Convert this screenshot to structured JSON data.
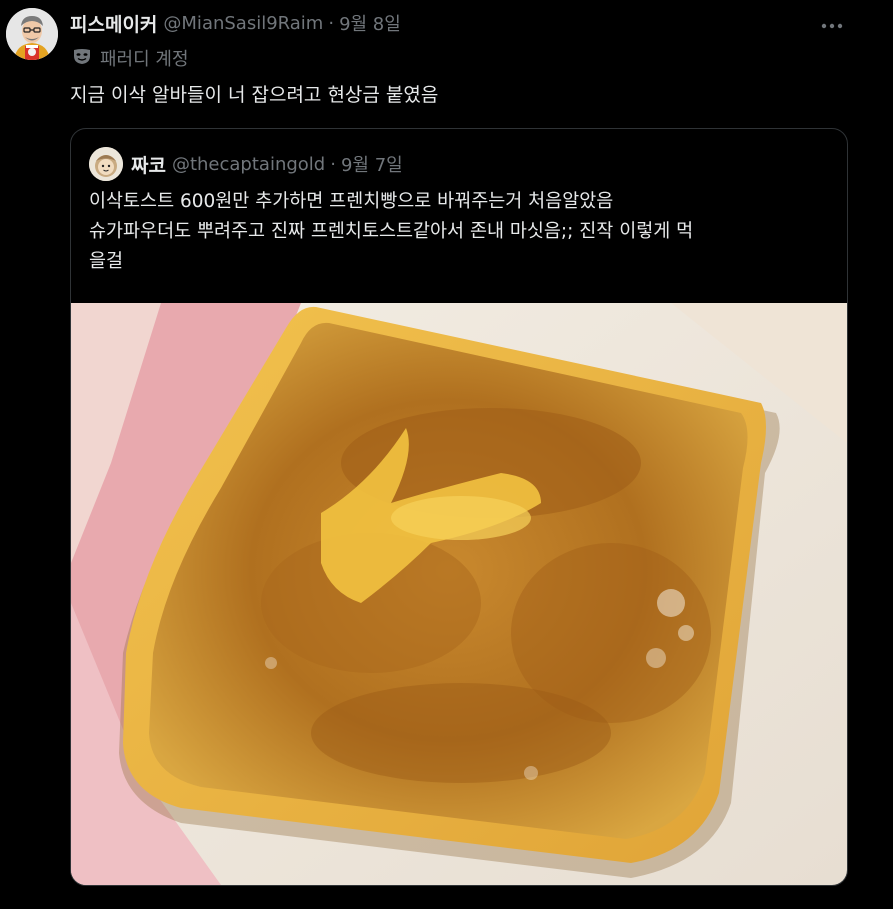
{
  "tweet": {
    "display_name": "피스메이커",
    "handle": "@MianSasil9Raim",
    "separator": "·",
    "date": "9월 8일",
    "label": "패러디 계정",
    "text": "지금 이삭 알바들이 너 잡으려고 현상금 붙였음",
    "more_icon": "more-horizontal-icon",
    "label_icon": "mask-icon"
  },
  "quote": {
    "display_name": "짜코",
    "handle": "@thecaptaingold",
    "separator": "·",
    "date": "9월 7일",
    "text_lines": [
      "이삭토스트 600원만 추가하면 프렌치빵으로 바꿔주는거 처음알았음",
      " 슈가파우더도 뿌려주고 진짜 프렌치토스트같아서 존내 마싯음;; 진작 이렇게 먹",
      "을걸"
    ]
  },
  "colors": {
    "background": "#000000",
    "text_primary": "#e7e9ea",
    "text_secondary": "#71767b",
    "border": "#2f3336"
  }
}
